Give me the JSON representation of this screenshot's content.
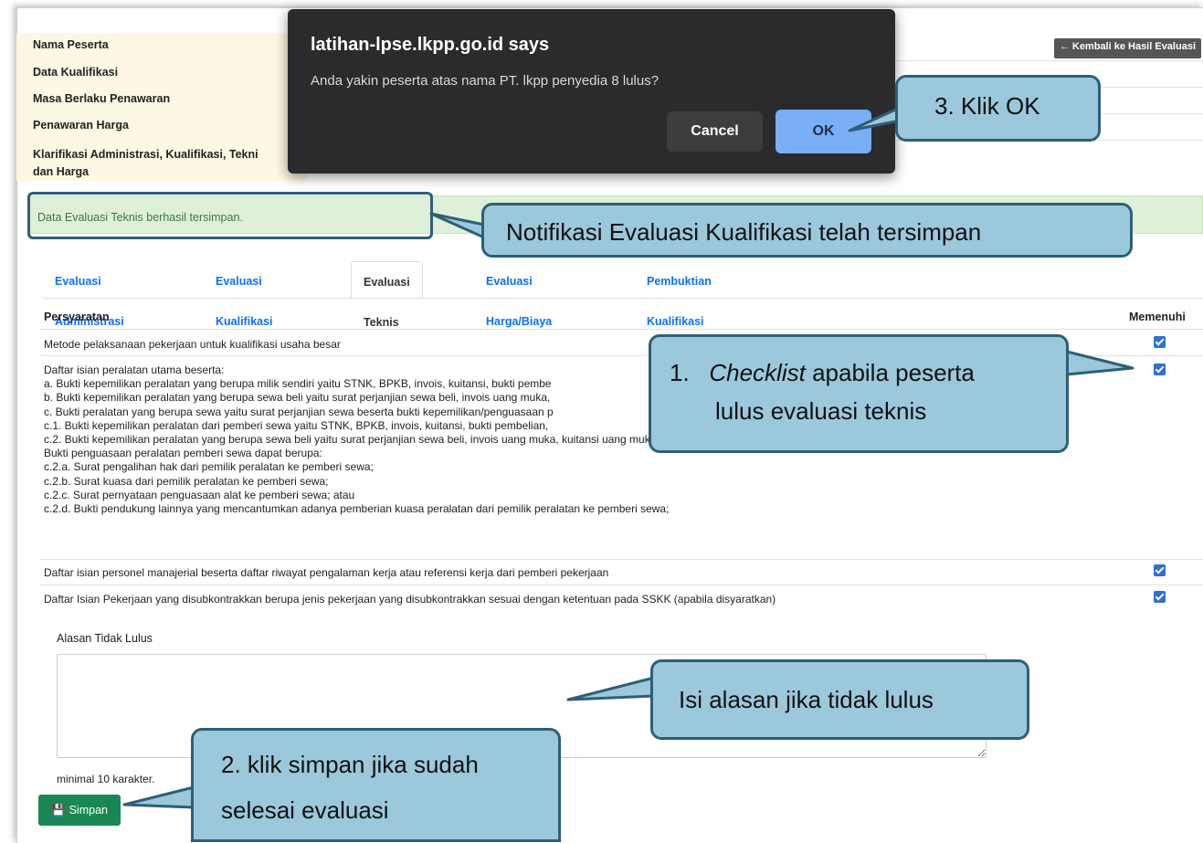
{
  "info": {
    "rows": [
      {
        "label": "Nama Peserta"
      },
      {
        "label": "Data Kualifikasi"
      },
      {
        "label": "Masa Berlaku Penawaran"
      },
      {
        "label": "Penawaran Harga"
      },
      {
        "label_line1": "Klarifikasi Administrasi, Kualifikasi, Tekni",
        "label_line2": "dan Harga"
      }
    ],
    "back_label": "← Kembali ke Hasil Evaluasi"
  },
  "alert": {
    "message": "Data Evaluasi Teknis berhasil tersimpan."
  },
  "tabs": [
    {
      "label": "Evaluasi Administrasi"
    },
    {
      "label": "Evaluasi Kualifikasi"
    },
    {
      "label": "Evaluasi Teknis"
    },
    {
      "label": "Evaluasi Harga/Biaya"
    },
    {
      "label": "Pembuktian Kualifikasi"
    }
  ],
  "requirements": {
    "header": "Persyaratan",
    "header_right": "Memenuhi",
    "items": [
      {
        "lines": [
          "Metode pelaksanaan pekerjaan untuk kualifikasi usaha besar"
        ],
        "checked": true
      },
      {
        "lines": [
          "Daftar isian peralatan utama beserta:",
          "a. Bukti kepemilikan peralatan yang berupa milik sendiri yaitu STNK, BPKB, invois, kuitansi, bukti pembe",
          "b. Bukti kepemilikan peralatan yang berupa sewa beli yaitu surat perjanjian sewa beli, invois uang muka,",
          "c. Bukti peralatan yang berupa sewa yaitu surat perjanjian sewa beserta bukti kepemilikan/penguasaan p",
          "c.1. Bukti kepemilikan peralatan dari pemberi sewa yaitu STNK, BPKB, invois, kuitansi, bukti pembelian,",
          "c.2. Bukti kepemilikan peralatan yang berupa sewa beli yaitu surat perjanjian sewa beli, invois uang muka, kuitansi uang muka, angsuran, atau bukti sewa beli lainnya;",
          "Bukti penguasaan peralatan pemberi sewa dapat berupa:",
          "c.2.a. Surat pengalihan hak dari pemilik peralatan ke pemberi sewa;",
          "c.2.b. Surat kuasa dari pemilik peralatan ke pemberi sewa;",
          "c.2.c. Surat pernyataan penguasaan alat ke pemberi sewa; atau",
          "c.2.d. Bukti pendukung lainnya yang mencantumkan adanya pemberian kuasa peralatan dari pemilik peralatan ke pemberi sewa;"
        ],
        "checked": true
      },
      {
        "lines": [
          "Daftar isian personel manajerial beserta daftar riwayat pengalaman kerja atau referensi kerja dari pemberi pekerjaan"
        ],
        "checked": true
      },
      {
        "lines": [
          "Daftar Isian Pekerjaan yang disubkontrakkan berupa jenis pekerjaan yang disubkontrakkan sesuai dengan ketentuan pada SSKK (apabila disyaratkan)"
        ],
        "checked": true
      }
    ]
  },
  "reason": {
    "label": "Alasan Tidak Lulus",
    "value": "",
    "hint": "minimal 10 karakter."
  },
  "save_label": "Simpan",
  "dialog": {
    "title": "latihan-lpse.lkpp.go.id says",
    "message": "Anda yakin peserta atas nama PT. lkpp penyedia 8 lulus?",
    "cancel_label": "Cancel",
    "ok_label": "OK"
  },
  "callouts": {
    "ok": "3. Klik OK",
    "notif": "Notifikasi Evaluasi Kualifikasi telah tersimpan",
    "checklist_num": "1.",
    "checklist_em": "Checklist",
    "checklist_rest": " apabila peserta",
    "checklist_line2": "lulus evaluasi teknis",
    "reason": "Isi alasan jika tidak lulus",
    "save_line1": "2. klik simpan jika sudah",
    "save_line2": "selesai evaluasi"
  },
  "colors": {
    "callout_fill": "#9cc8dc",
    "callout_border": "#2e5f78",
    "save_button": "#198754",
    "dialog_bg": "#2b2b2d",
    "ok_button": "#7aaef6",
    "tab_link": "#0d6efd"
  }
}
